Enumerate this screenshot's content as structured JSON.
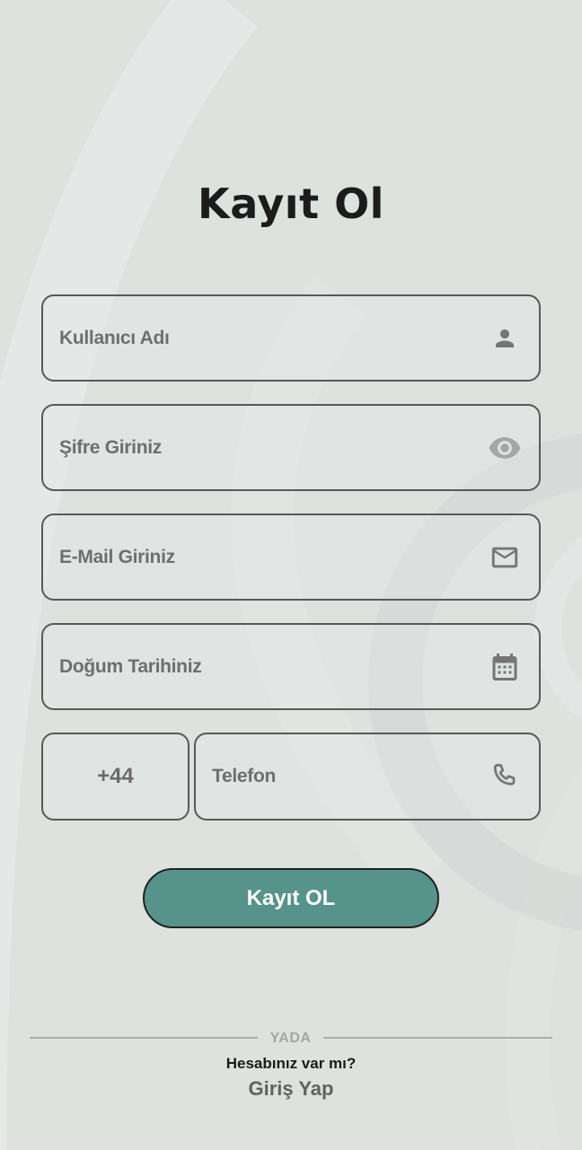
{
  "header": {
    "title": "Kayıt Ol"
  },
  "form": {
    "username": {
      "placeholder": "Kullanıcı Adı",
      "icon": "person-icon"
    },
    "password": {
      "placeholder": "Şifre Giriniz",
      "icon": "eye-icon"
    },
    "email": {
      "placeholder": "E-Mail Giriniz",
      "icon": "mail-icon"
    },
    "birthdate": {
      "placeholder": "Doğum Tarihiniz",
      "icon": "calendar-icon"
    },
    "country_code": {
      "value": "+44"
    },
    "phone": {
      "placeholder": "Telefon",
      "icon": "phone-icon"
    },
    "submit_label": "Kayıt OL"
  },
  "footer": {
    "divider_label": "YADA",
    "account_question": "Hesabınız var mı?",
    "login_link": "Giriş Yap"
  },
  "colors": {
    "background": "#dde2df",
    "accent": "#56938b",
    "field_border": "#555b59",
    "icon": "#757575"
  }
}
